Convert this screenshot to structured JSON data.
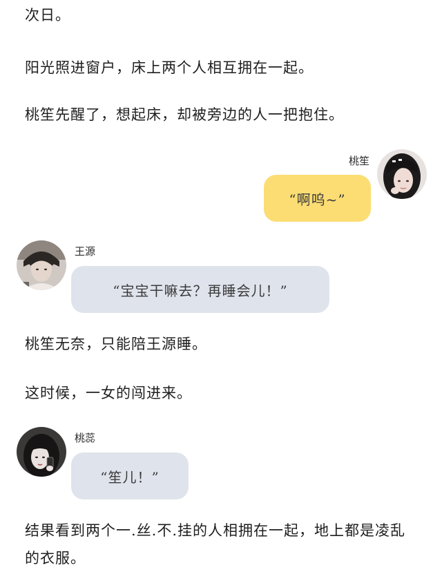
{
  "story": {
    "p1": "次日。",
    "p2": "阳光照进窗户，床上两个人相互拥在一起。",
    "p3": "桃笙先醒了，想起床，却被旁边的人一把抱住。",
    "p4": "桃笙无奈，只能陪王源睡。",
    "p5": "这时候，一女的闯进来。",
    "p6": "结果看到两个一.丝.不.挂的人相拥在一起，地上都是凌乱的衣服。"
  },
  "messages": [
    {
      "speaker": "桃笙",
      "text": "“啊呜~”",
      "side": "right",
      "bubble_color": "#fcdd74"
    },
    {
      "speaker": "王源",
      "text": "“宝宝干嘛去？再睡会儿！”",
      "side": "left",
      "bubble_color": "#dfe3ec"
    },
    {
      "speaker": "桃蕊",
      "text": "“笙儿！”",
      "side": "left",
      "bubble_color": "#dfe3ec"
    }
  ]
}
